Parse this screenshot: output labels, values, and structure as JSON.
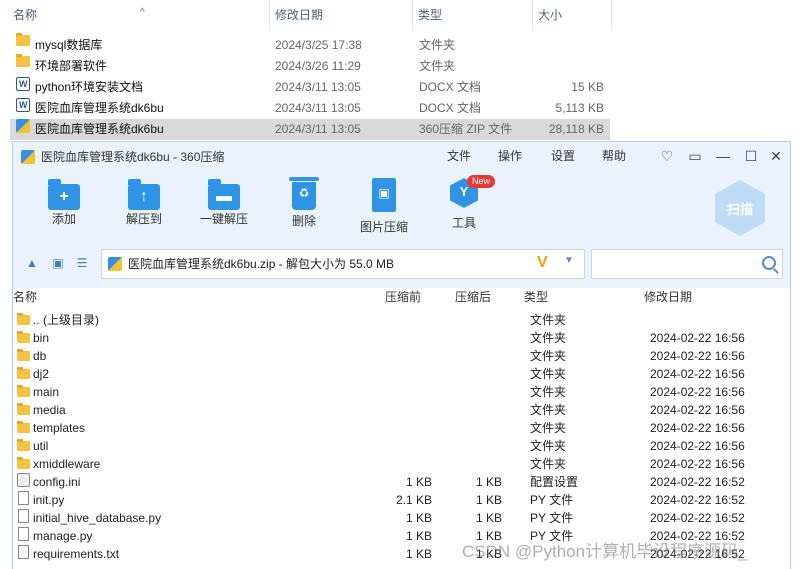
{
  "explorer": {
    "columns": {
      "name": "名称",
      "date": "修改日期",
      "type": "类型",
      "size": "大小"
    },
    "rows": [
      {
        "name": "mysql数据库",
        "date": "2024/3/25 17:38",
        "type": "文件夹",
        "size": "",
        "icon": "folder-icon"
      },
      {
        "name": "环境部署软件",
        "date": "2024/3/26 11:29",
        "type": "文件夹",
        "size": "",
        "icon": "folder-icon"
      },
      {
        "name": "python环境安装文档",
        "date": "2024/3/11 13:05",
        "type": "DOCX 文档",
        "size": "15 KB",
        "icon": "docx-icon"
      },
      {
        "name": "医院血库管理系统dk6bu",
        "date": "2024/3/11 13:05",
        "type": "DOCX 文档",
        "size": "5,113 KB",
        "icon": "docx-icon"
      },
      {
        "name": "医院血库管理系统dk6bu",
        "date": "2024/3/11 13:05",
        "type": "360压缩 ZIP 文件",
        "size": "28,118 KB",
        "icon": "zip-icon",
        "selected": true
      }
    ]
  },
  "app": {
    "title": "医院血库管理系统dk6bu - 360压缩",
    "menu": [
      "文件",
      "操作",
      "设置",
      "帮助"
    ],
    "toolbar": [
      {
        "label": "添加",
        "icon": "add-icon",
        "glyph": "+"
      },
      {
        "label": "解压到",
        "icon": "extract-to-icon",
        "glyph": "↑"
      },
      {
        "label": "一键解压",
        "icon": "one-click-extract-icon",
        "glyph": "▬"
      },
      {
        "label": "删除",
        "icon": "delete-icon",
        "glyph": "♻"
      },
      {
        "label": "图片压缩",
        "icon": "image-compress-icon",
        "glyph": "▣"
      },
      {
        "label": "工具",
        "icon": "tools-icon",
        "glyph": "Y"
      }
    ],
    "new_badge": "New",
    "scan_label": "扫描",
    "address": "医院血库管理系统dk6bu.zip - 解包大小为 55.0 MB",
    "address_logo": "V",
    "list": {
      "columns": {
        "name": "名称",
        "before": "压缩前",
        "after": "压缩后",
        "type": "类型",
        "date": "修改日期"
      },
      "rows": [
        {
          "name": ".. (上级目录)",
          "before": "",
          "after": "",
          "type": "文件夹",
          "date": "",
          "icon": "folder-icon"
        },
        {
          "name": "bin",
          "before": "",
          "after": "",
          "type": "文件夹",
          "date": "2024-02-22 16:56",
          "icon": "folder-icon"
        },
        {
          "name": "db",
          "before": "",
          "after": "",
          "type": "文件夹",
          "date": "2024-02-22 16:56",
          "icon": "folder-icon"
        },
        {
          "name": "dj2",
          "before": "",
          "after": "",
          "type": "文件夹",
          "date": "2024-02-22 16:56",
          "icon": "folder-icon"
        },
        {
          "name": "main",
          "before": "",
          "after": "",
          "type": "文件夹",
          "date": "2024-02-22 16:56",
          "icon": "folder-icon"
        },
        {
          "name": "media",
          "before": "",
          "after": "",
          "type": "文件夹",
          "date": "2024-02-22 16:56",
          "icon": "folder-icon"
        },
        {
          "name": "templates",
          "before": "",
          "after": "",
          "type": "文件夹",
          "date": "2024-02-22 16:56",
          "icon": "folder-icon"
        },
        {
          "name": "util",
          "before": "",
          "after": "",
          "type": "文件夹",
          "date": "2024-02-22 16:56",
          "icon": "folder-icon"
        },
        {
          "name": "xmiddleware",
          "before": "",
          "after": "",
          "type": "文件夹",
          "date": "2024-02-22 16:56",
          "icon": "folder-icon"
        },
        {
          "name": "config.ini",
          "before": "1 KB",
          "after": "1 KB",
          "type": "配置设置",
          "date": "2024-02-22 16:52",
          "icon": "config-file-icon"
        },
        {
          "name": "init.py",
          "before": "2.1 KB",
          "after": "1 KB",
          "type": "PY 文件",
          "date": "2024-02-22 16:52",
          "icon": "file-icon"
        },
        {
          "name": "initial_hive_database.py",
          "before": "1 KB",
          "after": "1 KB",
          "type": "PY 文件",
          "date": "2024-02-22 16:52",
          "icon": "file-icon"
        },
        {
          "name": "manage.py",
          "before": "1 KB",
          "after": "1 KB",
          "type": "PY 文件",
          "date": "2024-02-22 16:52",
          "icon": "file-icon"
        },
        {
          "name": "requirements.txt",
          "before": "1 KB",
          "after": "1 KB",
          "type": "",
          "date": "2024-02-22 16:52",
          "icon": "file-icon"
        }
      ]
    }
  },
  "watermark": "CSDN @Python计算机毕设程序源码_"
}
